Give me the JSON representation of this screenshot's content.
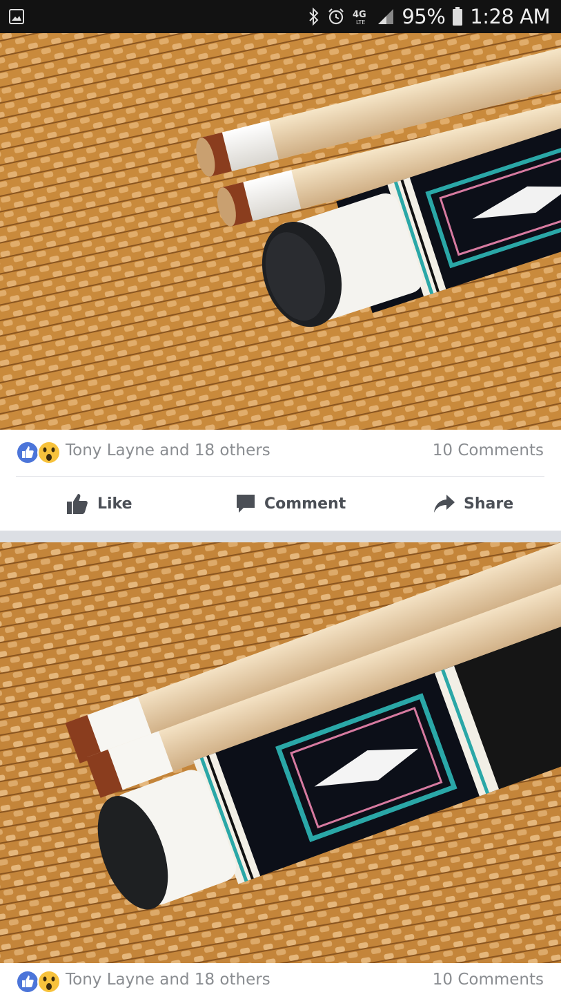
{
  "status_bar": {
    "battery_percent": "95%",
    "time": "1:28 AM",
    "network": "4G LTE",
    "icons": [
      "gallery-icon",
      "bluetooth-icon",
      "alarm-icon",
      "lte-icon",
      "signal-icon",
      "battery-icon"
    ]
  },
  "posts": [
    {
      "photo_subject": "pool-cue-photo",
      "reactions": {
        "icons": [
          "like-reaction-icon",
          "wow-reaction-icon"
        ],
        "names": "Tony Layne and 18 others",
        "comments": "10 Comments"
      },
      "actions": {
        "like": "Like",
        "comment": "Comment",
        "share": "Share"
      }
    },
    {
      "photo_subject": "pool-cue-photo",
      "reactions": {
        "icons": [
          "like-reaction-icon",
          "wow-reaction-icon"
        ],
        "names": "Tony Layne and 18 others",
        "comments": "10 Comments"
      }
    }
  ],
  "colors": {
    "like_blue": "#4267b2",
    "wow_yellow": "#f7c23c",
    "meta_grey": "#8a8d91",
    "action_grey": "#4b4f56",
    "feed_separator": "#dcdfe4"
  }
}
